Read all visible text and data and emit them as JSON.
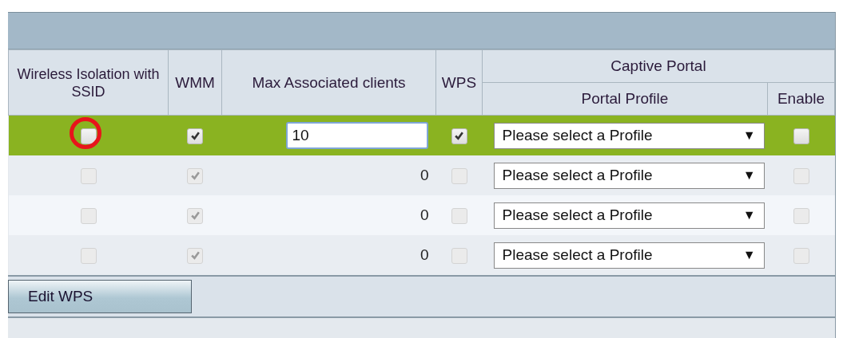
{
  "table": {
    "columns": {
      "isolation": "Wireless Isolation with SSID",
      "wmm": "WMM",
      "max_clients": "Max Associated clients",
      "wps": "WPS",
      "captive_portal": "Captive Portal",
      "portal_profile": "Portal Profile",
      "enable": "Enable"
    },
    "rows": [
      {
        "selected": true,
        "disabled": false,
        "isolation": false,
        "isolation_circled": true,
        "wmm": true,
        "max_clients": "10",
        "wps": true,
        "portal_profile": "Please select a Profile",
        "enable": false
      },
      {
        "selected": false,
        "disabled": true,
        "isolation": false,
        "isolation_circled": false,
        "wmm": true,
        "max_clients": "0",
        "wps": false,
        "portal_profile": "Please select a Profile",
        "enable": false
      },
      {
        "selected": false,
        "disabled": true,
        "isolation": false,
        "isolation_circled": false,
        "wmm": true,
        "max_clients": "0",
        "wps": false,
        "portal_profile": "Please select a Profile",
        "enable": false
      },
      {
        "selected": false,
        "disabled": true,
        "isolation": false,
        "isolation_circled": false,
        "wmm": true,
        "max_clients": "0",
        "wps": false,
        "portal_profile": "Please select a Profile",
        "enable": false
      }
    ]
  },
  "buttons": [
    {
      "label": "Edit WPS"
    }
  ],
  "dropdown_arrow": "▼"
}
